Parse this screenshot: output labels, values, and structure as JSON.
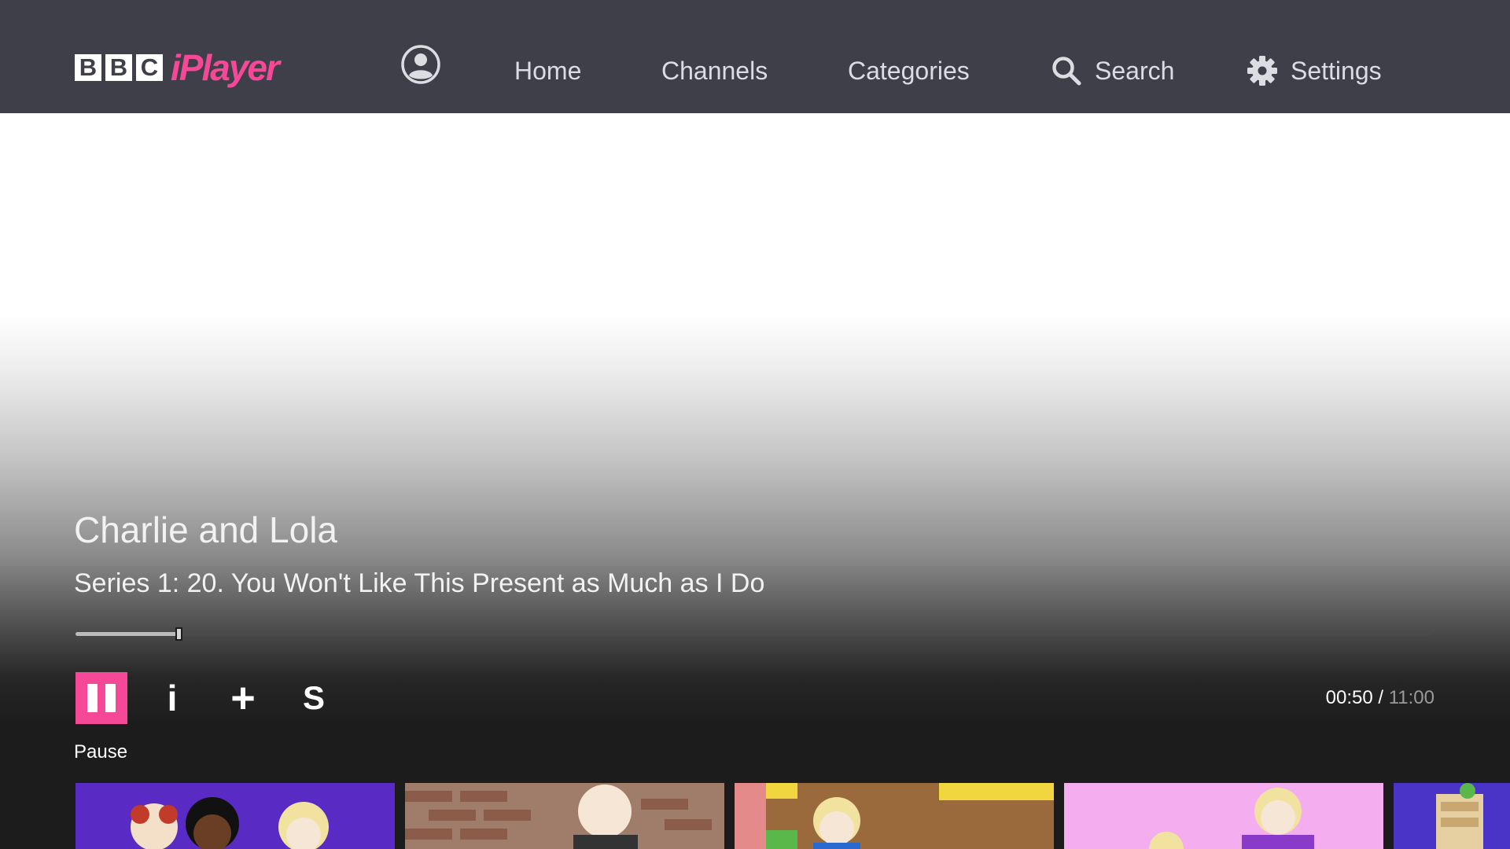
{
  "header": {
    "logo": {
      "bbc_letters": [
        "B",
        "B",
        "C"
      ],
      "wordmark": "iPlayer",
      "wordmark_color": "#f54997"
    },
    "account_icon": "user-circle-icon",
    "nav": {
      "home": "Home",
      "channels": "Channels",
      "categories": "Categories",
      "search": "Search",
      "settings": "Settings"
    },
    "search_icon": "search-icon",
    "settings_icon": "gear-icon",
    "background": "#3e3f48"
  },
  "player": {
    "title": "Charlie and Lola",
    "episode": "Series 1: 20. You Won't Like This Present as Much as I Do",
    "progress_fraction": 0.0758,
    "controls": {
      "pause_icon": "pause-icon",
      "info_glyph": "i",
      "add_glyph": "+",
      "subtitles_glyph": "S",
      "active_label": "Pause",
      "accent": "#f54997"
    },
    "time": {
      "current": "00:50",
      "separator": " / ",
      "total": "11:00"
    }
  },
  "thumbnails": [
    {
      "name": "episode-thumbnail-1",
      "bg": "#5a2bc4"
    },
    {
      "name": "episode-thumbnail-2",
      "bg": "#9a7a6c"
    },
    {
      "name": "episode-thumbnail-3",
      "bg": "#8a5a30"
    },
    {
      "name": "episode-thumbnail-4",
      "bg": "#f2a8f0"
    },
    {
      "name": "episode-thumbnail-5",
      "bg": "#4a34c8"
    }
  ]
}
